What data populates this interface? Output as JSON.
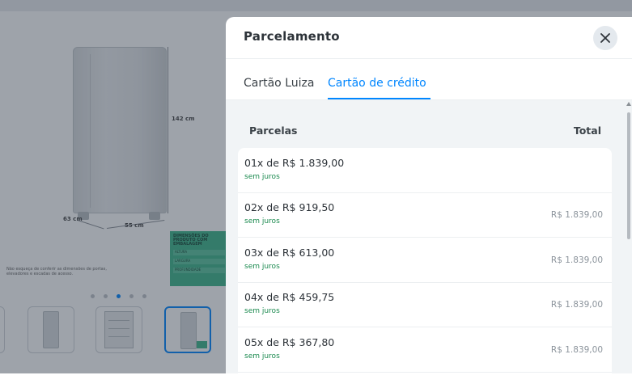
{
  "background_page": {
    "dimensions": {
      "height": "142 cm",
      "depth": "63 cm",
      "width": "55 cm"
    },
    "fine_print": "Não esqueça de conferir as dimensões de portas, elevadores e escadas de acesso.",
    "packaging_box": {
      "title": "DIMENSÕES DO PRODUTO COM EMBALAGEM",
      "rows": [
        "ALTURA",
        "LARGURA",
        "PROFUNDIDADE"
      ]
    },
    "carousel": {
      "total_slides": 5,
      "active_index": 2
    }
  },
  "modal": {
    "title": "Parcelamento",
    "tabs": [
      {
        "label": "Cartão Luiza",
        "active": false
      },
      {
        "label": "Cartão de crédito",
        "active": true
      }
    ],
    "columns": {
      "installments": "Parcelas",
      "total": "Total"
    },
    "rows": [
      {
        "installment": "01x de R$ 1.839,00",
        "interest": "sem juros",
        "total": ""
      },
      {
        "installment": "02x de R$ 919,50",
        "interest": "sem juros",
        "total": "R$ 1.839,00"
      },
      {
        "installment": "03x de R$ 613,00",
        "interest": "sem juros",
        "total": "R$ 1.839,00"
      },
      {
        "installment": "04x de R$ 459,75",
        "interest": "sem juros",
        "total": "R$ 1.839,00"
      },
      {
        "installment": "05x de R$ 367,80",
        "interest": "sem juros",
        "total": "R$ 1.839,00"
      }
    ]
  },
  "colors": {
    "accent": "#0086ff",
    "interest_free": "#1b8a4f",
    "overlay": "rgba(40, 52, 66, 0.45)"
  },
  "icons": {
    "close": "close-icon"
  }
}
